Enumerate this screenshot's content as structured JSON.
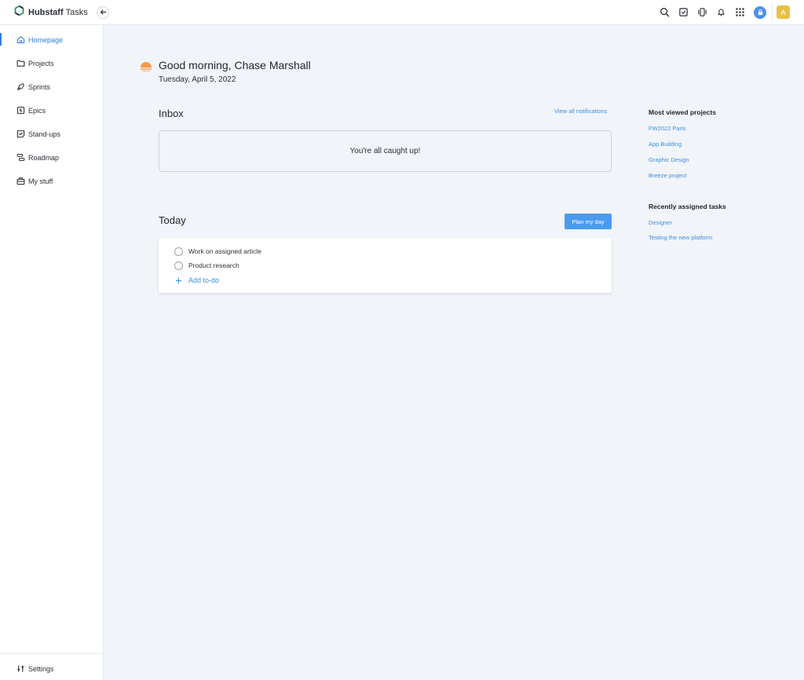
{
  "app": {
    "brand": "Hubstaff",
    "product": "Tasks",
    "accent_color": "#2f7fe0",
    "avatar_initial": "A"
  },
  "topbar": {
    "icons": [
      "search-icon",
      "task-check-icon",
      "timer-icon",
      "bell-icon",
      "apps-grid-icon",
      "lock-icon"
    ]
  },
  "sidebar": {
    "items": [
      {
        "label": "Homepage",
        "icon": "home-icon",
        "active": true
      },
      {
        "label": "Projects",
        "icon": "folder-icon",
        "active": false
      },
      {
        "label": "Sprints",
        "icon": "sprint-icon",
        "active": false
      },
      {
        "label": "Epics",
        "icon": "epic-icon",
        "active": false
      },
      {
        "label": "Stand-ups",
        "icon": "standup-icon",
        "active": false
      },
      {
        "label": "Roadmap",
        "icon": "roadmap-icon",
        "active": false
      },
      {
        "label": "My stuff",
        "icon": "briefcase-icon",
        "active": false
      }
    ],
    "settings_label": "Settings"
  },
  "main": {
    "greeting": "Good morning, Chase Marshall",
    "date": "Tuesday, April 5, 2022",
    "inbox": {
      "title": "Inbox",
      "view_all_label": "View all notifications",
      "empty_message": "You're all caught up!"
    },
    "today": {
      "title": "Today",
      "plan_button_label": "Plan my day",
      "todos": [
        {
          "text": "Work on assigned article",
          "done": false
        },
        {
          "text": "Product research",
          "done": false
        }
      ],
      "add_label": "Add to-do"
    }
  },
  "right_panel": {
    "most_viewed_title": "Most viewed projects",
    "projects": [
      "FW2022 Paris",
      "App Building",
      "Graphic Design",
      "Breeze project"
    ],
    "recent_tasks_title": "Recently assigned tasks",
    "tasks": [
      "Designer",
      "Testing the new platform"
    ]
  }
}
